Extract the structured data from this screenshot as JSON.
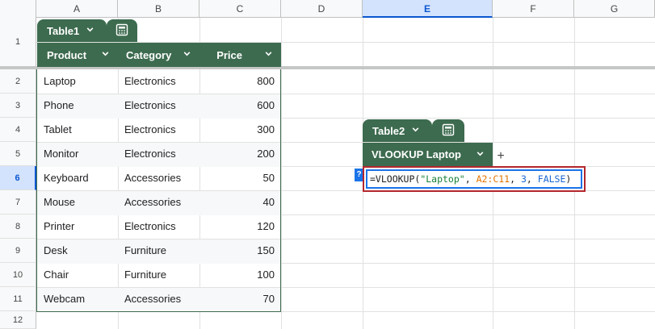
{
  "columns": [
    "A",
    "B",
    "C",
    "D",
    "E",
    "F",
    "G"
  ],
  "rows": [
    "1",
    "2",
    "3",
    "4",
    "5",
    "6",
    "7",
    "8",
    "9",
    "10",
    "11",
    "12"
  ],
  "table1": {
    "name": "Table1",
    "headers": [
      "Product",
      "Category",
      "Price"
    ],
    "data": [
      [
        "Laptop",
        "Electronics",
        "800"
      ],
      [
        "Phone",
        "Electronics",
        "600"
      ],
      [
        "Tablet",
        "Electronics",
        "300"
      ],
      [
        "Monitor",
        "Electronics",
        "200"
      ],
      [
        "Keyboard",
        "Accessories",
        "50"
      ],
      [
        "Mouse",
        "Accessories",
        "40"
      ],
      [
        "Printer",
        "Electronics",
        "120"
      ],
      [
        "Desk",
        "Furniture",
        "150"
      ],
      [
        "Chair",
        "Furniture",
        "100"
      ],
      [
        "Webcam",
        "Accessories",
        "70"
      ]
    ]
  },
  "table2": {
    "name": "Table2",
    "header": "VLOOKUP Laptop"
  },
  "formula": {
    "prefix": "=VLOOKUP(",
    "arg_string": "\"Laptop\"",
    "sep1": ", ",
    "arg_range": "A2:C11",
    "sep2": ", ",
    "arg_index": "3",
    "sep3": ", ",
    "arg_bool": "FALSE",
    "suffix": ")"
  },
  "help_badge": "?",
  "add_column": "+",
  "icons": {
    "tab_chevron": "chevron-down-icon",
    "calc": "calculator-icon",
    "add": "plus-icon",
    "help": "help-icon"
  },
  "colors": {
    "table_header": "#3d6b4f",
    "selection": "#1a73e8",
    "highlight_box": "#b3262e"
  }
}
